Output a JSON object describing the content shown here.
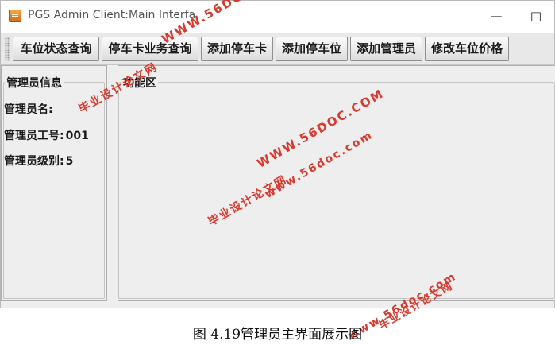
{
  "window": {
    "title": "PGS Admin Client:Main Interfa",
    "minimize_label": "—",
    "maximize_label": "□"
  },
  "toolbar": {
    "buttons": [
      {
        "label": "车位状态查询"
      },
      {
        "label": "停车卡业务查询"
      },
      {
        "label": "添加停车卡"
      },
      {
        "label": "添加停车位"
      },
      {
        "label": "添加管理员"
      },
      {
        "label": "修改车位价格"
      }
    ]
  },
  "left_panel": {
    "legend": "管理员信息",
    "name_label": "管理员名:",
    "name_value": "",
    "id_label": "管理员工号:",
    "id_value": "001",
    "level_label": "管理员级别:",
    "level_value": "5"
  },
  "right_panel": {
    "legend": "功能区"
  },
  "watermarks": {
    "site": "WWW.56DOC.COM",
    "site_lower": "www.56doc.com",
    "text": "毕业设计论文网",
    "color": "#d93a2f"
  },
  "caption": "图 4.19管理员主界面展示图"
}
